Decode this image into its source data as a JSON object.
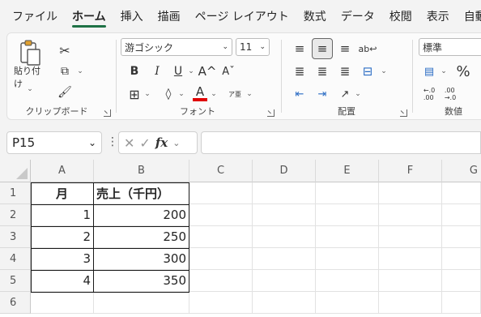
{
  "menu": {
    "tabs": [
      "ファイル",
      "ホーム",
      "挿入",
      "描画",
      "ページ レイアウト",
      "数式",
      "データ",
      "校閲",
      "表示",
      "自動"
    ],
    "active_index": 1
  },
  "ribbon": {
    "clipboard": {
      "paste_label": "貼り付け",
      "group_label": "クリップボード"
    },
    "font": {
      "font_name": "游ゴシック",
      "font_size": "11",
      "bold": "B",
      "italic": "I",
      "underline": "U",
      "grow": "A^",
      "shrink": "Aˇ",
      "font_color_letter": "A",
      "phonetic": "ア亜",
      "group_label": "フォント",
      "font_color": "#e00000"
    },
    "alignment": {
      "group_label": "配置"
    },
    "number": {
      "format": "標準",
      "percent": "%",
      "group_label": "数値"
    }
  },
  "formula_bar": {
    "name_box": "P15",
    "fx_label": "fx",
    "formula": ""
  },
  "sheet": {
    "columns": [
      "A",
      "B",
      "C",
      "D",
      "E",
      "F",
      "G"
    ],
    "rows": [
      "1",
      "2",
      "3",
      "4",
      "5",
      "6"
    ],
    "table": {
      "headers": [
        "月",
        "売上（千円）"
      ],
      "rows": [
        [
          "1",
          "200"
        ],
        [
          "2",
          "250"
        ],
        [
          "3",
          "300"
        ],
        [
          "4",
          "350"
        ]
      ]
    }
  }
}
